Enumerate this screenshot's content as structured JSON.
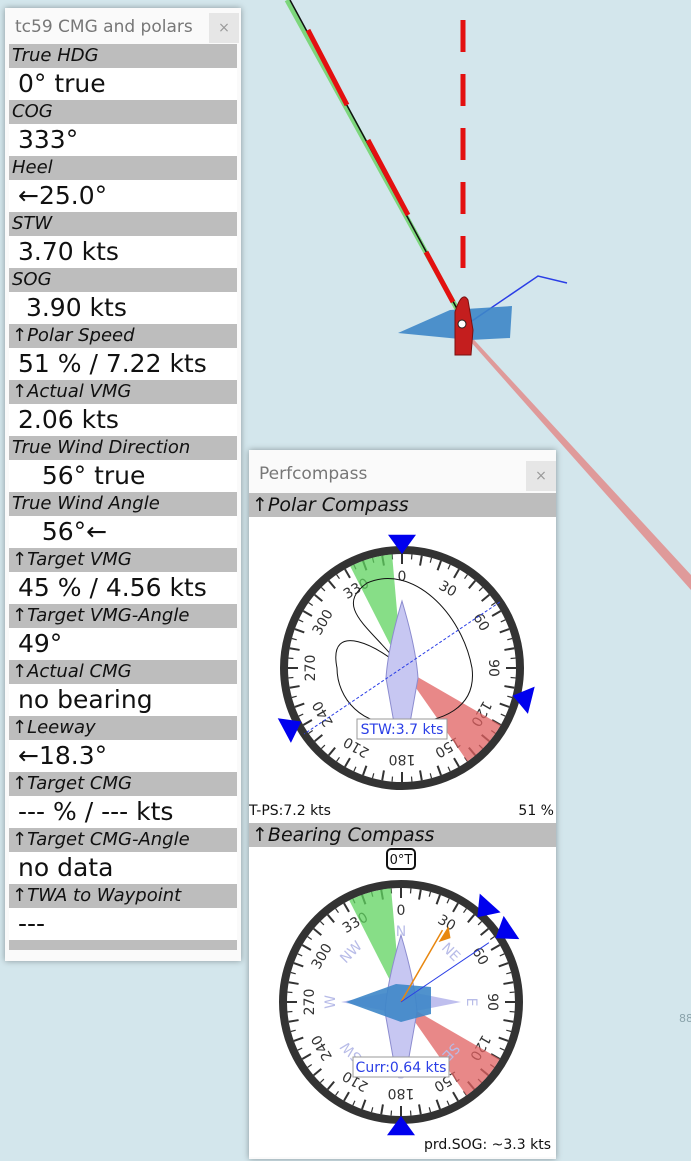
{
  "left_panel": {
    "title": "tc59 CMG and polars",
    "close_label": "×",
    "instruments": [
      {
        "caption": "True HDG",
        "value": "0° true"
      },
      {
        "caption": "COG",
        "value": "333°"
      },
      {
        "caption": "Heel",
        "value": "←25.0°"
      },
      {
        "caption": "STW",
        "value": "3.70 kts"
      },
      {
        "caption": "SOG",
        "value": " 3.90 kts"
      },
      {
        "caption": "↑Polar Speed",
        "value": "51 % / 7.22 kts"
      },
      {
        "caption": "↑Actual VMG",
        "value": "2.06 kts"
      },
      {
        "caption": "True Wind Direction",
        "value": "   56° true"
      },
      {
        "caption": "True Wind Angle",
        "value": "   56°←"
      },
      {
        "caption": "↑Target VMG",
        "value": "45 % / 4.56 kts"
      },
      {
        "caption": "↑Target VMG-Angle",
        "value": "49°"
      },
      {
        "caption": "↑Actual CMG",
        "value": "no bearing"
      },
      {
        "caption": "↑Leeway",
        "value": "←18.3°"
      },
      {
        "caption": "↑Target CMG",
        "value": "--- % / --- kts"
      },
      {
        "caption": "↑Target CMG-Angle",
        "value": "no data"
      },
      {
        "caption": "↑TWA to Waypoint",
        "value": "---"
      }
    ]
  },
  "perfcompass": {
    "title": "Perfcompass",
    "close_label": "×",
    "polar_caption": "↑Polar Compass",
    "bearing_caption": "↑Bearing Compass",
    "stw_label": "STW:3.7 kts",
    "tps_label": "T-PS:7.2 kts",
    "percent_label": "51 %",
    "curr_label": "Curr:0.64 kts",
    "true_north_badge": "0°T",
    "prd_sog_label": "prd.SOG: ~3.3 kts",
    "dial_labels": [
      "0",
      "30",
      "60",
      "90",
      "120",
      "150",
      "180",
      "210",
      "240",
      "270",
      "300",
      "330"
    ],
    "cardinal_labels": [
      "N",
      "NE",
      "E",
      "SE",
      "S",
      "SW",
      "W",
      "NW"
    ]
  },
  "chart_side_label": "88",
  "colors": {
    "water": "#d3e6ec",
    "caption_bg": "#bdbdbd",
    "laylines_green": "#5fd35f",
    "laylines_red": "#e06060",
    "marker_blue": "#0000ee"
  }
}
